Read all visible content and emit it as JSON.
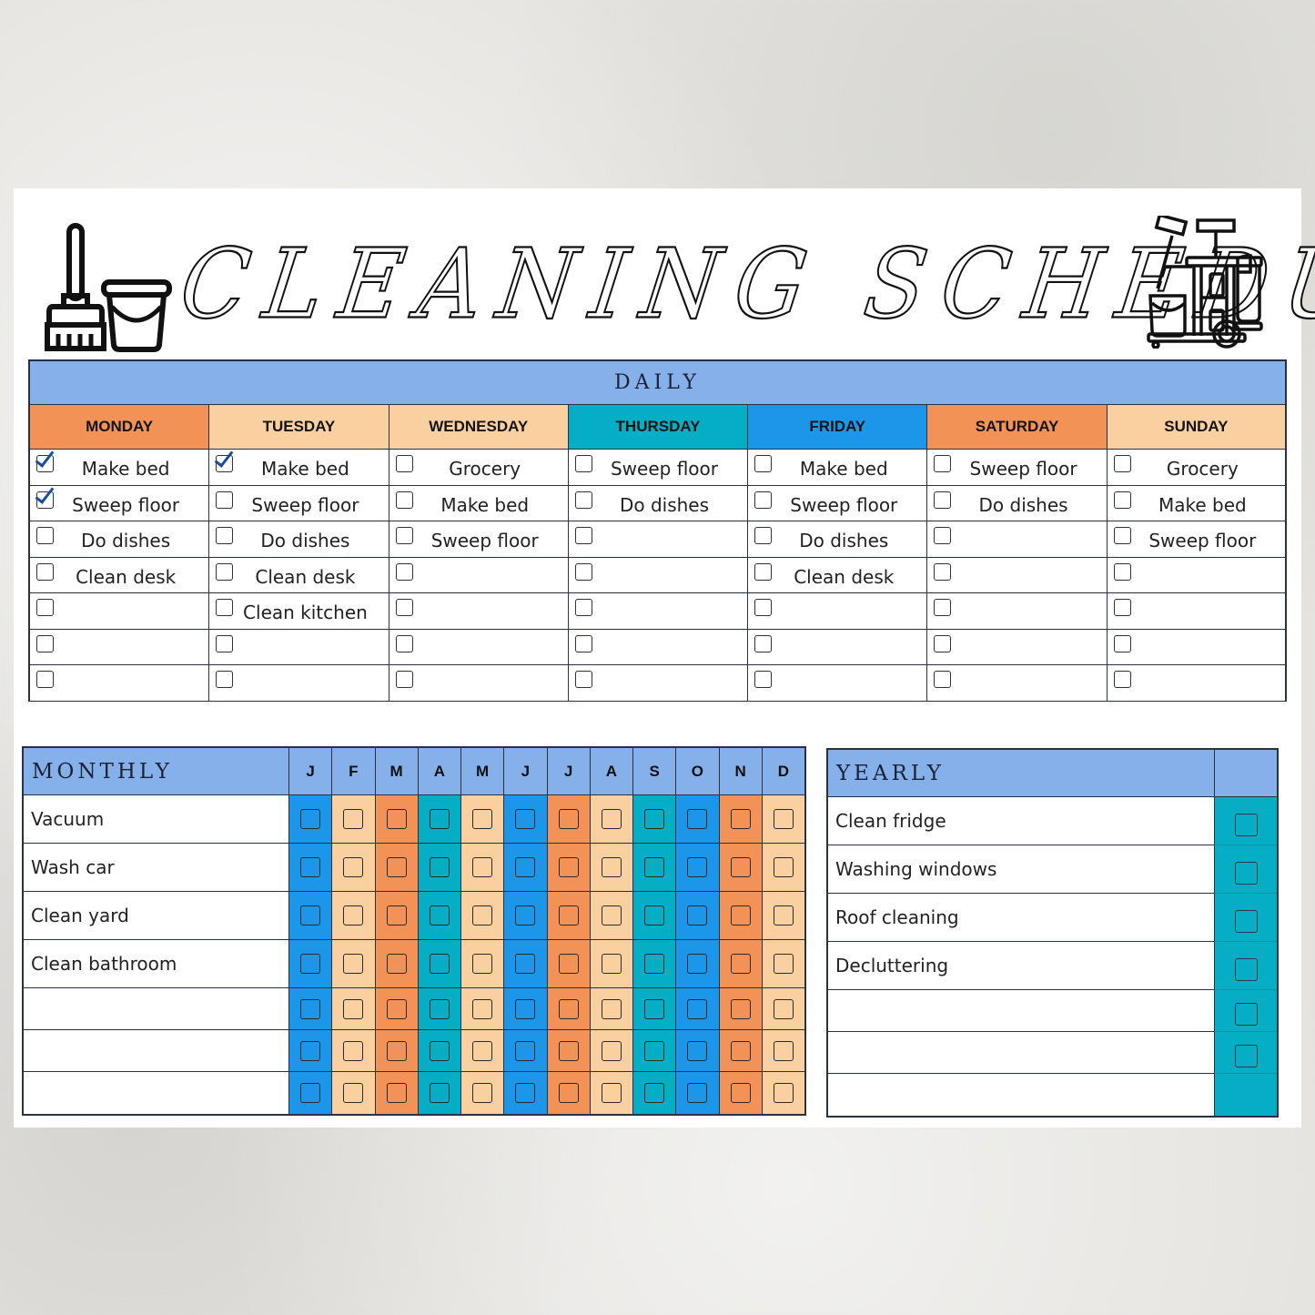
{
  "title": "CLEANING SCHEDULE",
  "icons": {
    "left_1": "broom-icon",
    "left_2": "bucket-icon",
    "right": "cleaning-cart-icon"
  },
  "colors": {
    "header_blue": "#86b0ea",
    "orange": "#f39257",
    "peach": "#fad0a0",
    "teal": "#05adc5",
    "blue": "#1b96e8",
    "check": "#1c4d96"
  },
  "daily": {
    "title": "DAILY",
    "days": [
      {
        "name": "MONDAY",
        "color": "#f39257",
        "tasks": [
          {
            "label": "Make bed",
            "checked": true
          },
          {
            "label": "Sweep floor",
            "checked": true
          },
          {
            "label": "Do dishes",
            "checked": false
          },
          {
            "label": "Clean desk",
            "checked": false
          },
          {
            "label": "",
            "checked": false
          },
          {
            "label": "",
            "checked": false
          },
          {
            "label": "",
            "checked": false
          }
        ]
      },
      {
        "name": "TUESDAY",
        "color": "#fad0a0",
        "tasks": [
          {
            "label": "Make bed",
            "checked": true
          },
          {
            "label": "Sweep floor",
            "checked": false
          },
          {
            "label": "Do dishes",
            "checked": false
          },
          {
            "label": "Clean desk",
            "checked": false
          },
          {
            "label": "Clean kitchen",
            "checked": false
          },
          {
            "label": "",
            "checked": false
          },
          {
            "label": "",
            "checked": false
          }
        ]
      },
      {
        "name": "WEDNESDAY",
        "color": "#fad0a0",
        "tasks": [
          {
            "label": "Grocery",
            "checked": false
          },
          {
            "label": "Make bed",
            "checked": false
          },
          {
            "label": "Sweep floor",
            "checked": false
          },
          {
            "label": "",
            "checked": false
          },
          {
            "label": "",
            "checked": false
          },
          {
            "label": "",
            "checked": false
          },
          {
            "label": "",
            "checked": false
          }
        ]
      },
      {
        "name": "THURSDAY",
        "color": "#05adc5",
        "tasks": [
          {
            "label": "Sweep floor",
            "checked": false
          },
          {
            "label": "Do dishes",
            "checked": false
          },
          {
            "label": "",
            "checked": false
          },
          {
            "label": "",
            "checked": false
          },
          {
            "label": "",
            "checked": false
          },
          {
            "label": "",
            "checked": false
          },
          {
            "label": "",
            "checked": false
          }
        ]
      },
      {
        "name": "FRIDAY",
        "color": "#1b96e8",
        "tasks": [
          {
            "label": "Make bed",
            "checked": false
          },
          {
            "label": "Sweep floor",
            "checked": false
          },
          {
            "label": "Do dishes",
            "checked": false
          },
          {
            "label": "Clean desk",
            "checked": false
          },
          {
            "label": "",
            "checked": false
          },
          {
            "label": "",
            "checked": false
          },
          {
            "label": "",
            "checked": false
          }
        ]
      },
      {
        "name": "SATURDAY",
        "color": "#f39257",
        "tasks": [
          {
            "label": "Sweep floor",
            "checked": false
          },
          {
            "label": "Do dishes",
            "checked": false
          },
          {
            "label": "",
            "checked": false
          },
          {
            "label": "",
            "checked": false
          },
          {
            "label": "",
            "checked": false
          },
          {
            "label": "",
            "checked": false
          },
          {
            "label": "",
            "checked": false
          }
        ]
      },
      {
        "name": "SUNDAY",
        "color": "#fad0a0",
        "tasks": [
          {
            "label": "Grocery",
            "checked": false
          },
          {
            "label": "Make bed",
            "checked": false
          },
          {
            "label": "Sweep floor",
            "checked": false
          },
          {
            "label": "",
            "checked": false
          },
          {
            "label": "",
            "checked": false
          },
          {
            "label": "",
            "checked": false
          },
          {
            "label": "",
            "checked": false
          }
        ]
      }
    ]
  },
  "monthly": {
    "title": "MONTHLY",
    "months": [
      "J",
      "F",
      "M",
      "A",
      "M",
      "J",
      "J",
      "A",
      "S",
      "O",
      "N",
      "D"
    ],
    "month_colors": [
      "#1b96e8",
      "#fad0a0",
      "#f39257",
      "#05adc5",
      "#fad0a0",
      "#1b96e8",
      "#f39257",
      "#fad0a0",
      "#05adc5",
      "#1b96e8",
      "#f39257",
      "#fad0a0"
    ],
    "tasks": [
      "Vacuum",
      "Wash car",
      "Clean yard",
      "Clean bathroom",
      "",
      "",
      ""
    ]
  },
  "yearly": {
    "title": "YEARLY",
    "tasks": [
      "Clean fridge",
      "Washing windows",
      "Roof cleaning",
      "Decluttering",
      "",
      "",
      ""
    ]
  }
}
